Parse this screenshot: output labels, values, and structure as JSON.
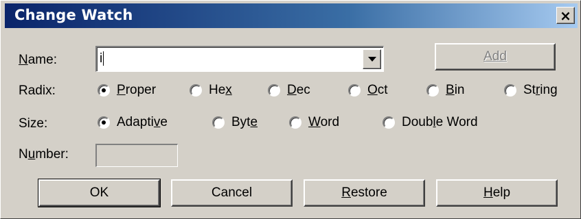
{
  "window": {
    "title": "Change Watch",
    "close_glyph": "×"
  },
  "name_row": {
    "label": "Name:",
    "value": "i",
    "add_button": "Add"
  },
  "radix": {
    "label": "Radix:",
    "options": [
      {
        "label": "Proper",
        "selected": true
      },
      {
        "label": "Hex",
        "selected": false
      },
      {
        "label": "Dec",
        "selected": false
      },
      {
        "label": "Oct",
        "selected": false
      },
      {
        "label": "Bin",
        "selected": false
      },
      {
        "label": "String",
        "selected": false
      }
    ]
  },
  "size": {
    "label": "Size:",
    "options": [
      {
        "label": "Adaptive",
        "selected": true
      },
      {
        "label": "Byte",
        "selected": false
      },
      {
        "label": "Word",
        "selected": false
      },
      {
        "label": "Double Word",
        "selected": false
      }
    ]
  },
  "number": {
    "label": "Number:",
    "value": ""
  },
  "buttons": {
    "ok": "OK",
    "cancel": "Cancel",
    "restore": "Restore",
    "help": "Help"
  },
  "colors": {
    "title_start": "#0a246a",
    "title_end": "#a6caf0",
    "face": "#d4d0c8"
  }
}
